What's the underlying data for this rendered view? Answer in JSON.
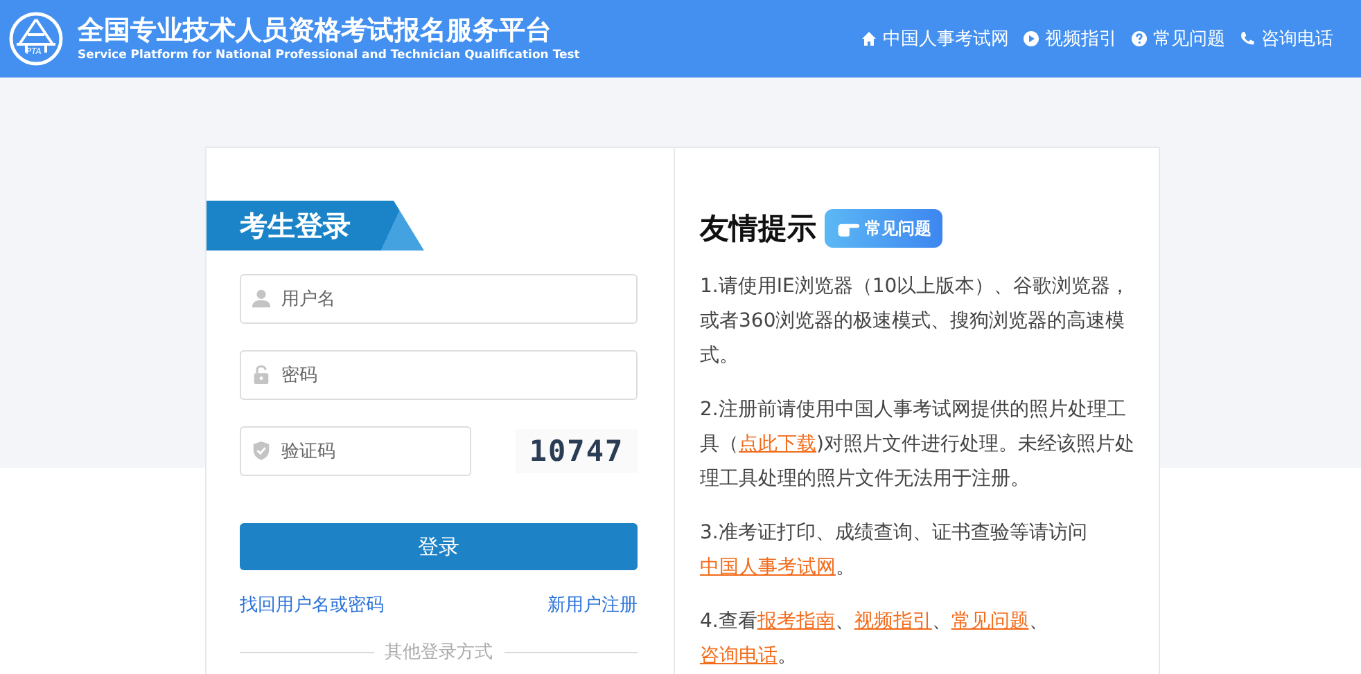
{
  "header": {
    "title": "全国专业技术人员资格考试报名服务平台",
    "subtitle": "Service Platform for National Professional and Technician Qualification Test",
    "logo_text": "PTA",
    "nav": [
      {
        "label": "中国人事考试网"
      },
      {
        "label": "视频指引"
      },
      {
        "label": "常见问题"
      },
      {
        "label": "咨询电话"
      }
    ]
  },
  "login": {
    "title": "考生登录",
    "fields": [
      {
        "placeholder": "用户名"
      },
      {
        "placeholder": "密码"
      },
      {
        "placeholder": "验证码"
      }
    ],
    "captcha": "10747",
    "submit": "登录",
    "forgot": "找回用户名或密码",
    "register": "新用户注册",
    "other": "其他登录方式"
  },
  "tips": {
    "title": "友情提示",
    "faq_button": "常见问题",
    "paragraphs": [
      [
        {
          "text": "1.请使用IE浏览器（10以上版本）、谷歌浏览器，或者360浏览器的极速模式、搜狗浏览器的高速模式。",
          "kind": "text"
        }
      ],
      [
        {
          "text": "2.注册前请使用中国人事考试网提供的照片处理工具（",
          "kind": "text"
        },
        {
          "text": "点此下载",
          "kind": "link"
        },
        {
          "text": ")对照片文件进行处理。未经该照片处理工具处理的照片文件无法用于注册。",
          "kind": "text"
        }
      ],
      [
        {
          "text": "3.准考证打印、成绩查询、证书查验等请访问",
          "kind": "text"
        },
        {
          "text": "中国人事考试网",
          "kind": "link"
        },
        {
          "text": "。",
          "kind": "text"
        }
      ],
      [
        {
          "text": "4.查看",
          "kind": "text"
        },
        {
          "text": "报考指南",
          "kind": "link"
        },
        {
          "text": "、",
          "kind": "text"
        },
        {
          "text": "视频指引",
          "kind": "link"
        },
        {
          "text": "、",
          "kind": "text"
        },
        {
          "text": "常见问题",
          "kind": "link"
        },
        {
          "text": "、",
          "kind": "text"
        },
        {
          "text": "咨询电话",
          "kind": "link"
        },
        {
          "text": "。",
          "kind": "text"
        }
      ]
    ]
  }
}
